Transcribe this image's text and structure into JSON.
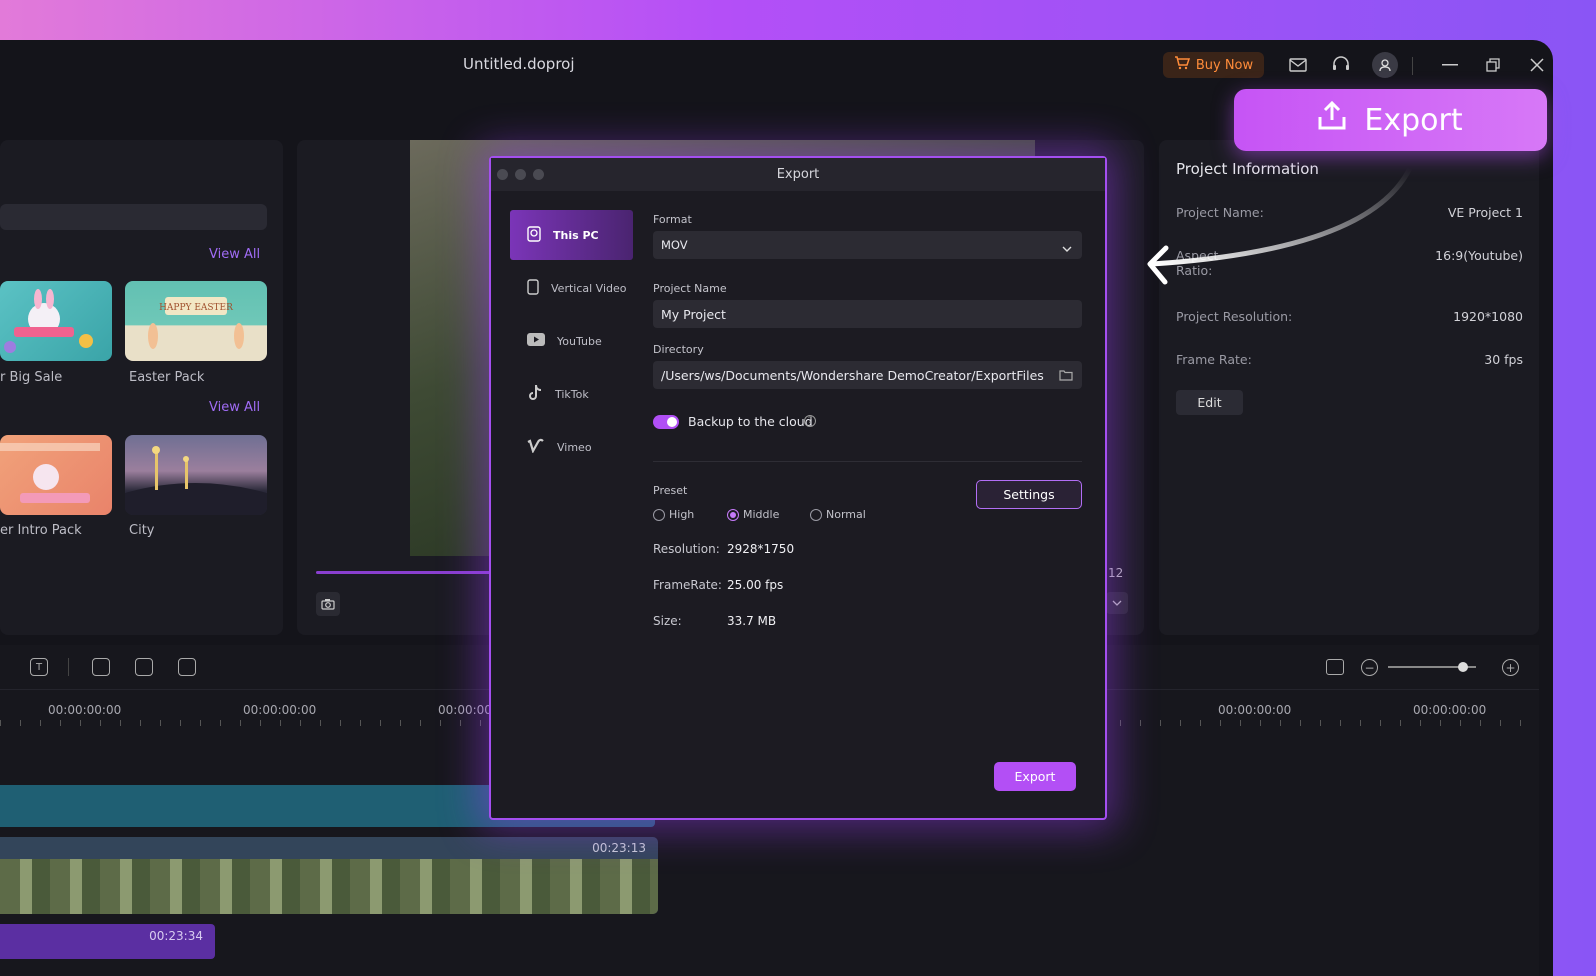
{
  "titlebar": {
    "file_title": "Untitled.doproj",
    "buy_now": "Buy Now"
  },
  "callout": {
    "export_label": "Export"
  },
  "templates": {
    "view_all_1": "View All",
    "view_all_2": "View All",
    "items": [
      {
        "label": "r Big Sale"
      },
      {
        "label": "Easter Pack"
      },
      {
        "label": "er Intro Pack"
      },
      {
        "label": "City"
      }
    ]
  },
  "preview": {
    "time_suffix": ":12"
  },
  "project_info": {
    "title": "Project Information",
    "rows": [
      {
        "key": "Project Name:",
        "value": "VE Project 1"
      },
      {
        "key": "Aspect Ratio:",
        "value": "16:9(Youtube)"
      },
      {
        "key": "Project Resolution:",
        "value": "1920*1080"
      },
      {
        "key": "Frame Rate:",
        "value": "30 fps"
      }
    ],
    "edit": "Edit"
  },
  "timeline": {
    "ruler": [
      "00:00:00:00",
      "00:00:00:00",
      "00:00:00:",
      "00:00:00:00",
      "00:00:00:00"
    ],
    "clip_video_time": "00:23:13",
    "clip_audio_time": "00:23:34",
    "zoom_level": 0.85
  },
  "dialog": {
    "title": "Export",
    "nav": [
      {
        "label": "This PC",
        "icon": "pc-icon"
      },
      {
        "label": "Vertical Video",
        "icon": "phone-icon"
      },
      {
        "label": "YouTube",
        "icon": "youtube-icon"
      },
      {
        "label": "TikTok",
        "icon": "tiktok-icon"
      },
      {
        "label": "Vimeo",
        "icon": "vimeo-icon"
      }
    ],
    "format_label": "Format",
    "format_value": "MOV",
    "project_name_label": "Project Name",
    "project_name_value": "My Project",
    "directory_label": "Directory",
    "directory_value": "/Users/ws/Documents/Wondershare DemoCreator/ExportFiles",
    "backup_label": "Backup to the cloud",
    "backup_enabled": true,
    "preset_label": "Preset",
    "presets": [
      "High",
      "Middle",
      "Normal"
    ],
    "preset_selected": "Middle",
    "settings": "Settings",
    "resolution_label": "Resolution:",
    "resolution_value": "2928*1750",
    "framerate_label": "FrameRate:",
    "framerate_value": "25.00 fps",
    "size_label": "Size:",
    "size_value": "33.7 MB",
    "export": "Export"
  },
  "colors": {
    "accent": "#b34ff5",
    "buy_now": "#ff8c3a",
    "background": "#14141a"
  }
}
